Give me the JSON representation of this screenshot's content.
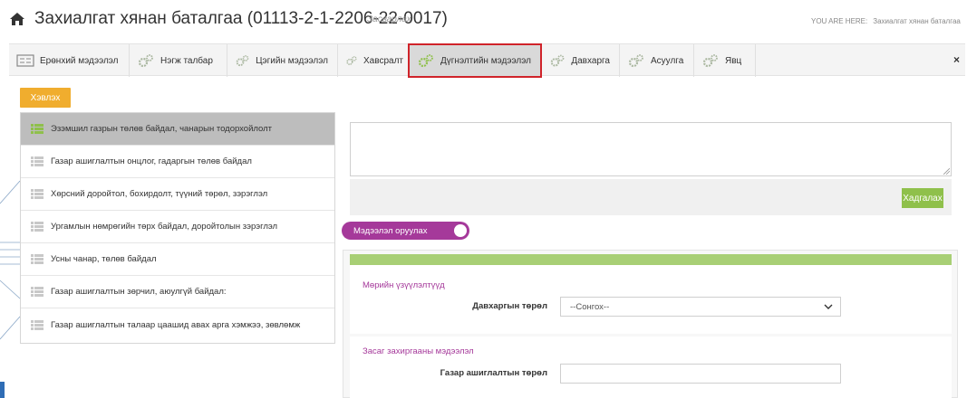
{
  "header": {
    "title": "Захиалгат хянан баталгаа (01113-2-1-2206-22-0017)",
    "subtitle": "Засварлах",
    "breadcrumb_label": "YOU ARE HERE:",
    "breadcrumb_page": "Захиалгат хянан баталгаа"
  },
  "tabs": [
    {
      "label": "Ерөнхий мэдээлэл",
      "icon": "form-icon"
    },
    {
      "label": "Нэгж талбар",
      "icon": "gears-icon"
    },
    {
      "label": "Цэгийн мэдээлэл",
      "icon": "gears-icon"
    },
    {
      "label": "Хавсралт",
      "icon": "gears-icon"
    },
    {
      "label": "Дүгнэлтийн мэдээлэл",
      "icon": "gears-icon",
      "active": true
    },
    {
      "label": "Давхарга",
      "icon": "gears-icon"
    },
    {
      "label": "Асуулга",
      "icon": "gears-icon"
    },
    {
      "label": "Явц",
      "icon": "gears-icon"
    }
  ],
  "close_label": "×",
  "print_button": "Хэвлэх",
  "left_list": [
    {
      "label": "Эзэмшил газрын төлөв байдал, чанарын тодорхойлолт",
      "active": true
    },
    {
      "label": "Газар ашиглалтын онцлог, гадаргын төлөв байдал"
    },
    {
      "label": "Хөрсний доройтол, бохирдолт, түүний төрөл, зэрэглэл"
    },
    {
      "label": "Ургамлын нөмрөгийн төрх байдал, доройтолын зэрэглэл"
    },
    {
      "label": "Усны чанар, төлөв байдал"
    },
    {
      "label": "Газар ашиглалтын зөрчил, аюулгүй байдал:"
    },
    {
      "label": "Газар ашиглалтын талаар цаашид авах арга хэмжээ, зөвлөмж"
    }
  ],
  "comment": {
    "value": ""
  },
  "save_button": "Хадгалах",
  "toggle_label": "Мэдээлэл оруулах",
  "sections": {
    "s1_title": "Мөрийн үзүүлэлтүүд",
    "s1_field_label": "Давхаргын төрөл",
    "s1_select_value": "--Сонгох--",
    "s2_title": "Засаг захиргааны мэдээлэл",
    "s2_field_label": "Газар ашиглалтын төрөл",
    "s2_input_value": ""
  },
  "colors": {
    "accent_purple": "#a5399a",
    "save_green": "#8fc04b",
    "print_orange": "#f0ad2e",
    "active_tab_outline": "#d0232a",
    "list_icon_green": "#8fc04b"
  }
}
